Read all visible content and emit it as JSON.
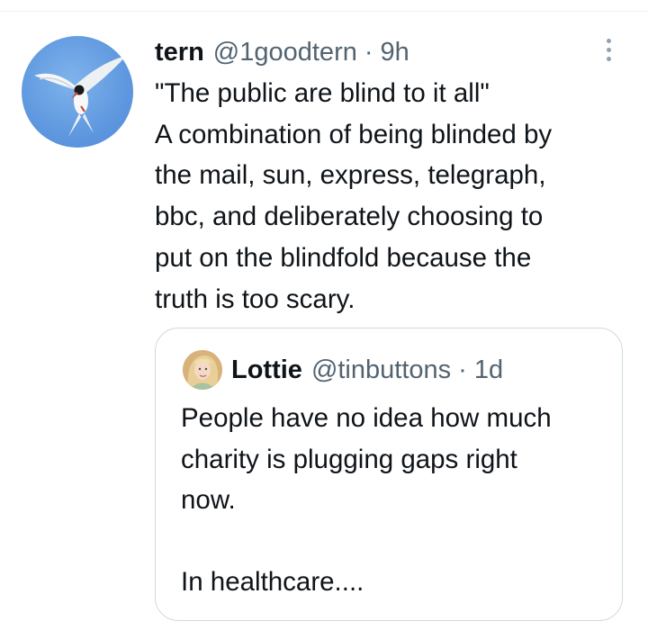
{
  "tweet": {
    "author_name": "tern",
    "author_handle": "@1goodtern",
    "separator": "·",
    "time": "9h",
    "avatar_icon": "tern-bird-avatar",
    "more_icon": "more-vertical-icon",
    "text_lines": [
      "\"The public are blind to it all\"",
      "A combination of being blinded by",
      "the mail, sun, express, telegraph,",
      "bbc, and deliberately choosing to",
      "put on the blindfold because the",
      "truth is too scary."
    ]
  },
  "quoted_tweet": {
    "author_name": "Lottie",
    "author_handle": "@tinbuttons",
    "separator": "·",
    "time": "1d",
    "avatar_icon": "user-avatar",
    "text_lines": [
      "People have no idea how much",
      "charity is plugging gaps right",
      "now.",
      "",
      "In healthcare...."
    ]
  },
  "colors": {
    "text_primary": "#0f1419",
    "text_secondary": "#536471",
    "border": "#cfd9de",
    "avatar_sky": "#5f98df"
  }
}
